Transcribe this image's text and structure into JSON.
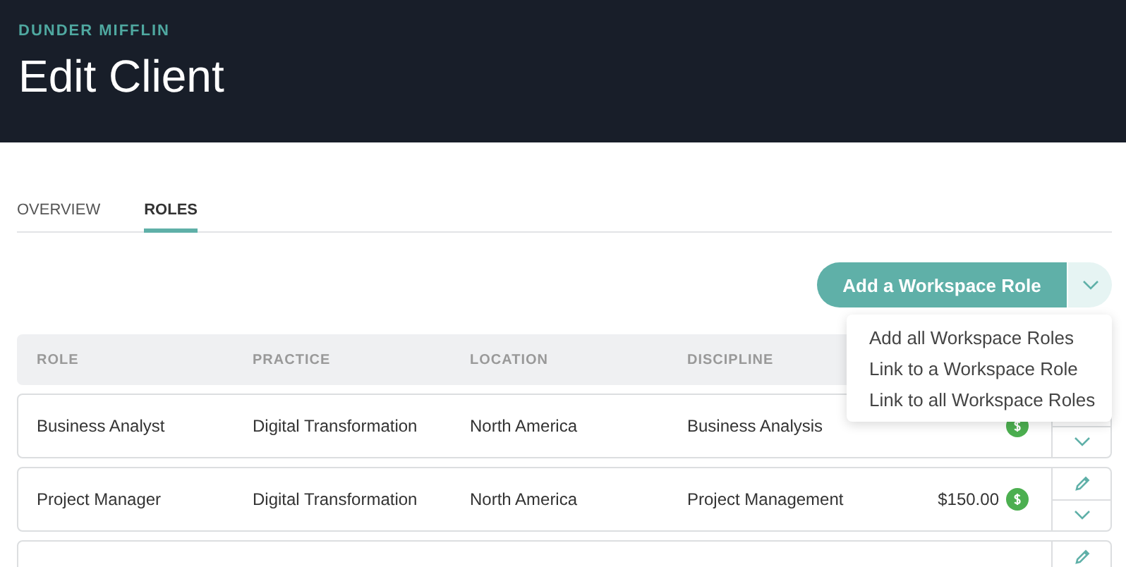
{
  "header": {
    "brand": "DUNDER MIFFLIN",
    "title": "Edit Client"
  },
  "tabs": [
    {
      "label": "OVERVIEW",
      "selected": false
    },
    {
      "label": "ROLES",
      "selected": true
    }
  ],
  "primary_button": {
    "label": "Add a Workspace Role"
  },
  "dropdown": {
    "expanded": true,
    "items": [
      "Add all Workspace Roles",
      "Link to a Workspace Role",
      "Link to all Workspace Roles"
    ]
  },
  "table": {
    "columns": [
      "ROLE",
      "PRACTICE",
      "LOCATION",
      "DISCIPLINE"
    ],
    "rows": [
      {
        "role": "Business Analyst",
        "practice": "Digital Transformation",
        "location": "North America",
        "discipline": "Business Analysis",
        "partial": false
      },
      {
        "role": "Project Manager",
        "practice": "Digital Transformation",
        "location": "North America",
        "discipline": "Project Management",
        "rate": "$150.00",
        "partial": false
      },
      {
        "partial": true
      }
    ]
  }
}
